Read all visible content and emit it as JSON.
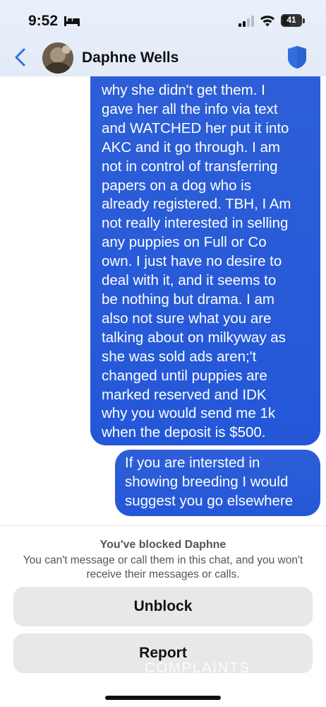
{
  "status_bar": {
    "time": "9:52",
    "battery": "41",
    "battery_level": 0.41,
    "icons": [
      "bed-icon",
      "signal-icon",
      "wifi-icon",
      "battery-icon"
    ]
  },
  "header": {
    "contact_name": "Daphne Wells",
    "icons": [
      "back-chevron-icon",
      "avatar",
      "shield-icon"
    ],
    "accent_color": "#2f6fe0"
  },
  "messages": [
    {
      "sender": "me",
      "lines": [
        "why she didn't get them. I",
        "gave her all the info via text",
        "and WATCHED her put it into",
        "AKC and it go through. I am",
        "not in control of transferring",
        "papers on a dog who is",
        "already registered. TBH, I Am",
        "not really interested in selling",
        "any puppies on Full or Co",
        "own. I just have no desire to",
        "deal with it, and it seems to",
        "be nothing but drama. I am",
        "also not sure what you are",
        "talking about on milkyway as",
        "she was sold ads aren;'t",
        "changed until puppies are",
        "marked reserved and IDK",
        "why you would send me 1k",
        "when the deposit is $500."
      ]
    },
    {
      "sender": "me",
      "lines": [
        "If you are intersted in",
        "showing breeding I would",
        "suggest you go elsewhere"
      ]
    }
  ],
  "blocked_panel": {
    "title": "You've blocked Daphne",
    "description": "You can't message or call them in this chat, and you won't receive their messages or calls.",
    "unblock_label": "Unblock",
    "report_label": "Report"
  },
  "watermark": "COMPLAINTS",
  "colors": {
    "bubble": "#2a5bd8",
    "header_bg": "#e7eefa",
    "button_bg": "#e8e8ea"
  }
}
